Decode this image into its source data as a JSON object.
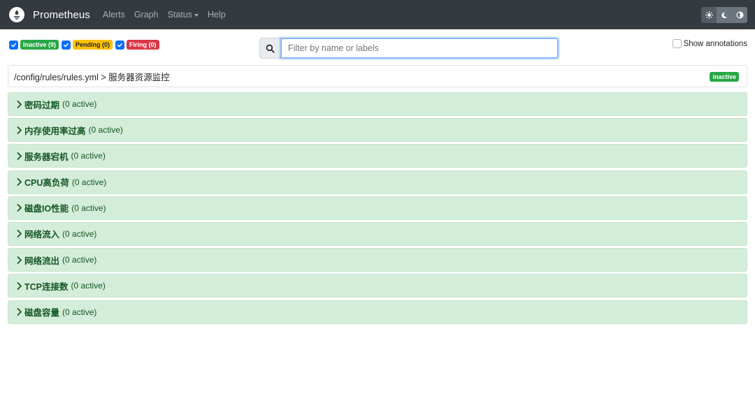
{
  "navbar": {
    "brand": "Prometheus",
    "links": [
      "Alerts",
      "Graph",
      "Status",
      "Help"
    ],
    "theme_buttons": [
      "sun-icon",
      "moon-icon",
      "contrast-icon"
    ]
  },
  "filters": {
    "inactive_label": "Inactive (9)",
    "pending_label": "Pending (0)",
    "firing_label": "Firing (0)",
    "colors": {
      "inactive": "#28a745",
      "pending": "#ffc107",
      "firing": "#dc3545"
    }
  },
  "search": {
    "placeholder": "Filter by name or labels",
    "value": ""
  },
  "annotations": {
    "label": "Show annotations",
    "checked": false
  },
  "group": {
    "path": "/config/rules/rules.yml > 服务器资源监控",
    "status": "inactive"
  },
  "rules": [
    {
      "name": "密码过期",
      "count": "(0 active)"
    },
    {
      "name": "内存使用率过高",
      "count": "(0 active)"
    },
    {
      "name": "服务器宕机",
      "count": "(0 active)"
    },
    {
      "name": "CPU高负荷",
      "count": "(0 active)"
    },
    {
      "name": "磁盘IO性能",
      "count": "(0 active)"
    },
    {
      "name": "网络流入",
      "count": "(0 active)"
    },
    {
      "name": "网络流出",
      "count": "(0 active)"
    },
    {
      "name": "TCP连接数",
      "count": "(0 active)"
    },
    {
      "name": "磁盘容量",
      "count": "(0 active)"
    }
  ]
}
